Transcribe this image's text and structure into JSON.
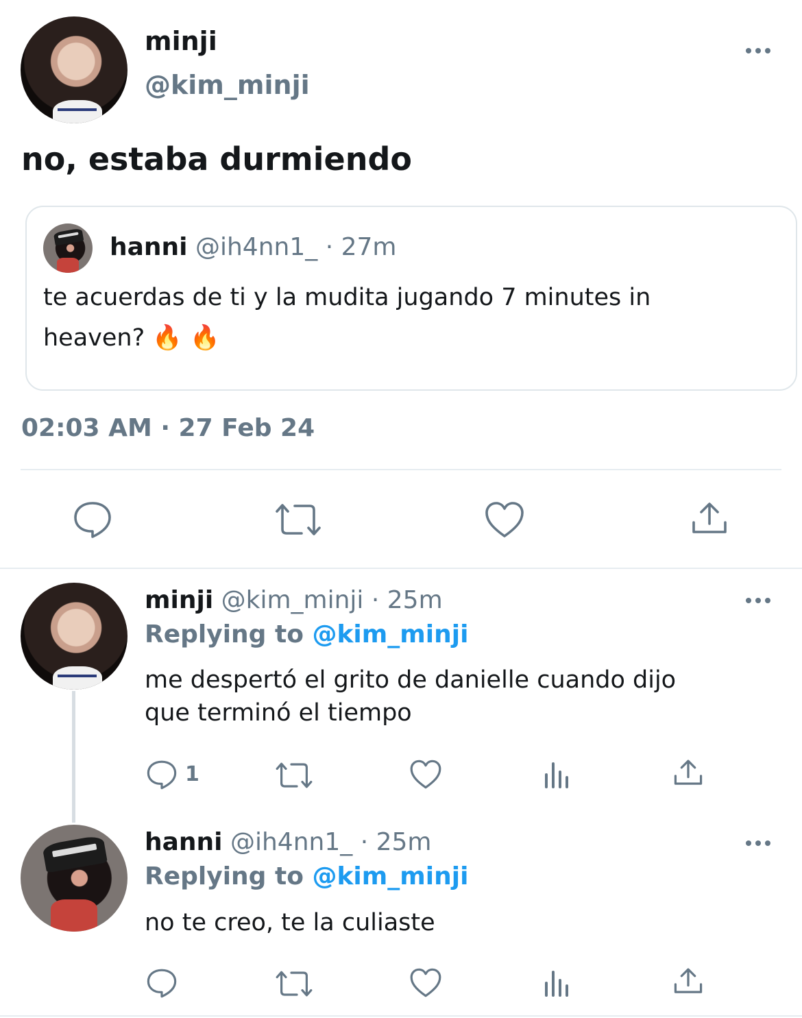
{
  "main_tweet": {
    "display_name": "minji",
    "handle": "@kim_minji",
    "text": "no, estaba durmiendo",
    "timestamp": "02:03 AM · 27 Feb 24",
    "more_icon": "more-horizontal-icon",
    "quoted": {
      "display_name": "hanni",
      "handle": "@ih4nn1_",
      "time": "· 27m",
      "text_line1": "te acuerdas de ti y la mudita jugando 7 minutes in",
      "text_line2": "heaven? 🔥 🔥"
    },
    "actions": [
      "reply-icon",
      "retweet-icon",
      "like-icon",
      "share-icon"
    ]
  },
  "replies": [
    {
      "display_name": "minji",
      "handle": "@kim_minji",
      "time": "· 25m",
      "replying_label": "Replying to",
      "replying_handle": "@kim_minji",
      "text_line1": "me despertó el grito de danielle cuando dijo",
      "text_line2": "que terminó el tiempo",
      "reply_count": "1"
    },
    {
      "display_name": "hanni",
      "handle": "@ih4nn1_",
      "time": "· 25m",
      "replying_label": "Replying to",
      "replying_handle": "@kim_minji",
      "text_line1": "no te creo, te la culiaste",
      "reply_count": ""
    }
  ],
  "colors": {
    "text": "#14171a",
    "muted": "#657786",
    "link": "#1d9bf0",
    "divider": "#e6ecf0"
  }
}
